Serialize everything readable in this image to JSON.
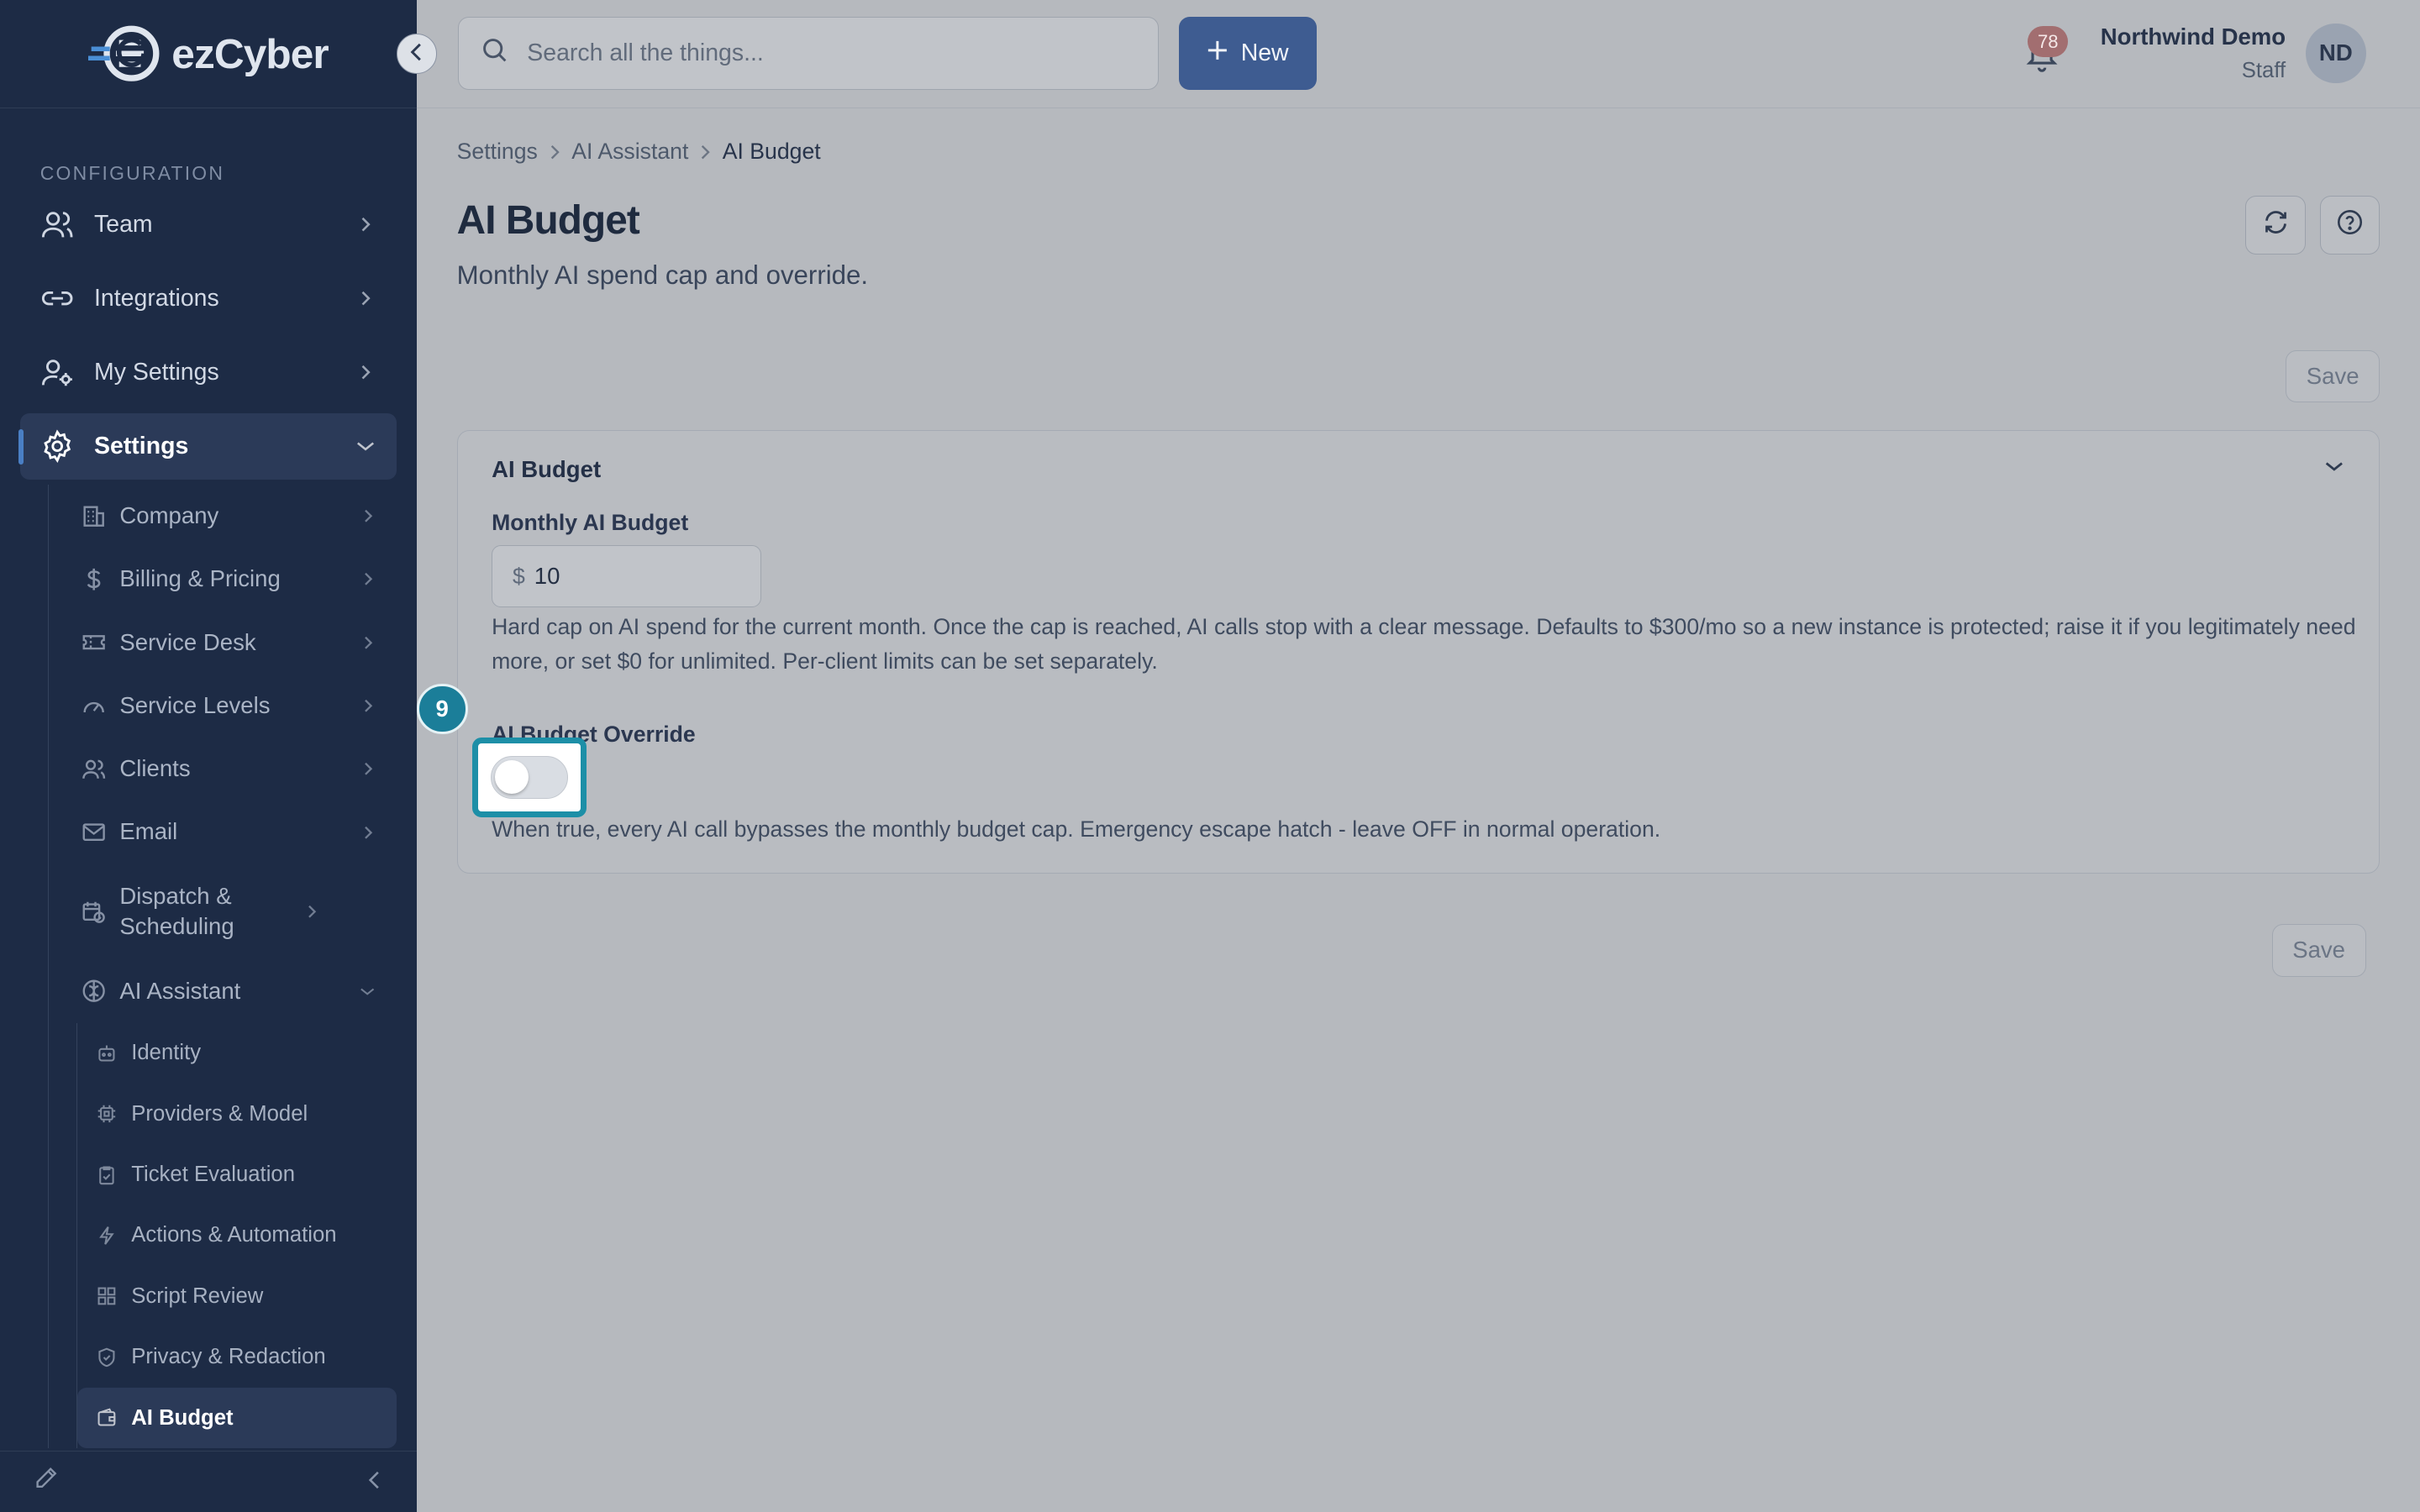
{
  "app": {
    "logo_text": "ezCyber"
  },
  "sidebar": {
    "section_label": "CONFIGURATION",
    "top_items": [
      {
        "label": "Team",
        "icon": "users-icon"
      },
      {
        "label": "Integrations",
        "icon": "link-icon"
      },
      {
        "label": "My Settings",
        "icon": "user-cog-icon"
      },
      {
        "label": "Settings",
        "icon": "gear-icon",
        "active": true
      }
    ],
    "settings_items": [
      {
        "label": "Company",
        "icon": "building-icon"
      },
      {
        "label": "Billing & Pricing",
        "icon": "dollar-icon"
      },
      {
        "label": "Service Desk",
        "icon": "ticket-icon"
      },
      {
        "label": "Service Levels",
        "icon": "gauge-icon"
      },
      {
        "label": "Clients",
        "icon": "users-icon"
      },
      {
        "label": "Email",
        "icon": "mail-icon"
      },
      {
        "label": "Dispatch & Scheduling",
        "icon": "calendar-clock-icon"
      },
      {
        "label": "AI Assistant",
        "icon": "brain-icon",
        "expanded": true
      }
    ],
    "ai_items": [
      {
        "label": "Identity",
        "icon": "bot-icon"
      },
      {
        "label": "Providers & Model",
        "icon": "cpu-icon"
      },
      {
        "label": "Ticket Evaluation",
        "icon": "clipboard-check-icon"
      },
      {
        "label": "Actions & Automation",
        "icon": "bolt-icon"
      },
      {
        "label": "Script Review",
        "icon": "grid-icon"
      },
      {
        "label": "Privacy & Redaction",
        "icon": "shield-icon"
      },
      {
        "label": "AI Budget",
        "icon": "wallet-icon",
        "active": true
      }
    ]
  },
  "topbar": {
    "search_placeholder": "Search all the things...",
    "new_label": "New",
    "notification_count": "78",
    "user_name": "Northwind Demo",
    "user_role": "Staff",
    "avatar_initials": "ND"
  },
  "breadcrumb": [
    "Settings",
    "AI Assistant",
    "AI Budget"
  ],
  "page": {
    "title": "AI Budget",
    "subtitle": "Monthly AI spend cap and override.",
    "save_label": "Save"
  },
  "card": {
    "title": "AI Budget",
    "budget_label": "Monthly AI Budget",
    "currency_symbol": "$",
    "budget_value": "10",
    "budget_help": "Hard cap on AI spend for the current month. Once the cap is reached, AI calls stop with a clear message. Defaults to $300/mo so a new instance is protected; raise it if you legitimately need more, or set $0 for unlimited. Per-client limits can be set separately.",
    "override_label": "AI Budget Override",
    "override_on": false,
    "override_help": "When true, every AI call bypasses the monthly budget cap. Emergency escape hatch - leave OFF in normal operation."
  },
  "annotation": {
    "step_number": "9"
  },
  "colors": {
    "sidebar_bg": "#1d2b45",
    "primary_button": "#3e5c91",
    "highlight_ring": "#1d8fa7",
    "badge": "#a26e70"
  }
}
